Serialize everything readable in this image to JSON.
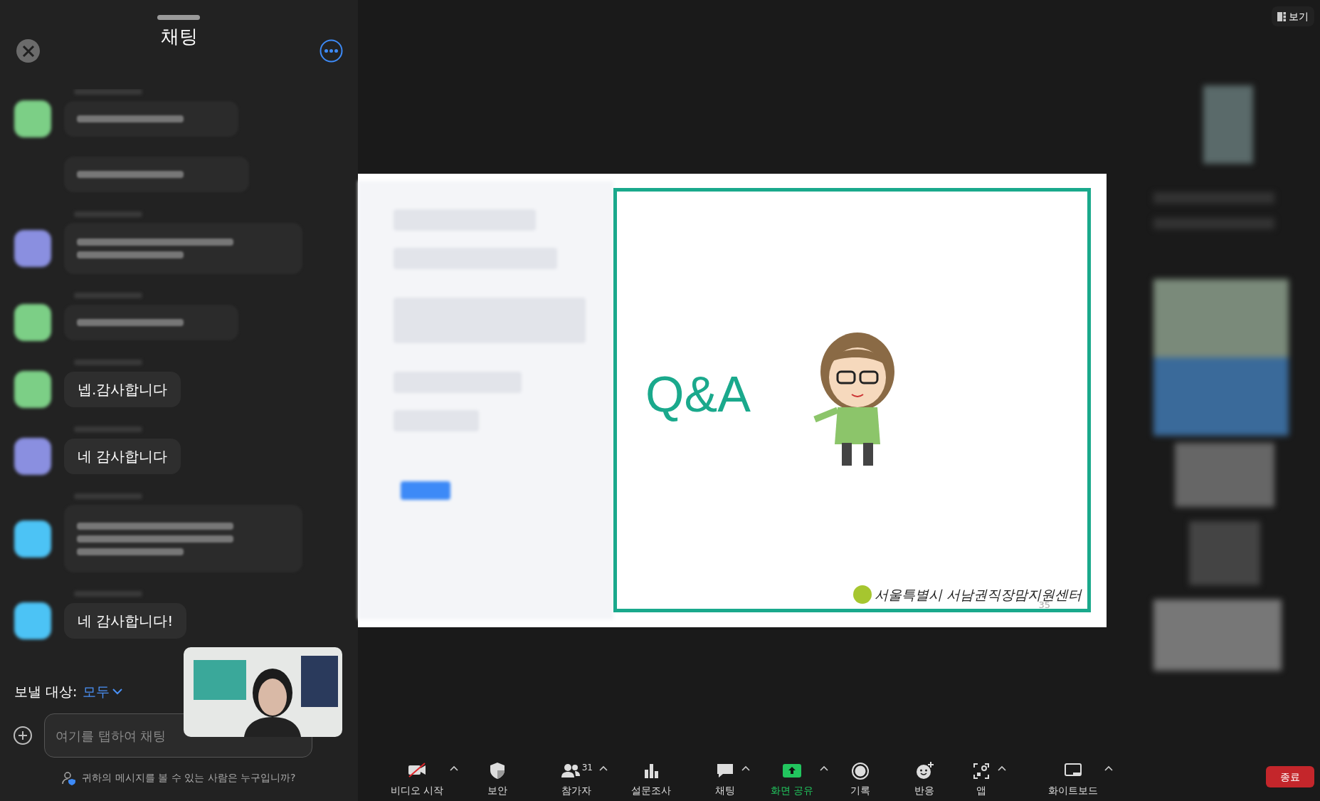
{
  "chat_panel": {
    "title": "채팅",
    "messages": [
      {
        "kind": "redacted-one-line",
        "color": "#7ccf86"
      },
      {
        "kind": "redacted-followup"
      },
      {
        "kind": "redacted-two-line",
        "color": "#8a8fe0"
      },
      {
        "kind": "redacted-one-line",
        "color": "#7ccf86"
      },
      {
        "kind": "text",
        "text": "넵.감사합니다",
        "color": "#7ccf86"
      },
      {
        "kind": "text",
        "text": "네 감사합니다",
        "color": "#8a8fe0"
      },
      {
        "kind": "redacted-three-line",
        "color": "#4cc3f5"
      },
      {
        "kind": "text",
        "text": "네 감사합니다!",
        "color": "#4cc3f5"
      }
    ],
    "send_to": {
      "label": "보낼 대상:",
      "value": "모두"
    },
    "input": {
      "placeholder": "여기를 탭하여 채팅"
    },
    "privacy_note": "귀하의 메시지를 볼 수 있는 사람은 누구입니까?"
  },
  "view_button": {
    "label": "보기"
  },
  "slide": {
    "title": "Q&A",
    "footer": "서울특별시 서남권직장맘지원센터",
    "page": "35"
  },
  "toolbar": [
    {
      "kind": "video-off",
      "label": "비디오 시작",
      "caret": true,
      "on": false
    },
    {
      "kind": "shield",
      "label": "보안",
      "caret": false,
      "on": false
    },
    {
      "kind": "people",
      "label": "참가자",
      "badge": "31",
      "caret": true,
      "on": false
    },
    {
      "kind": "chart",
      "label": "설문조사",
      "caret": false,
      "on": false
    },
    {
      "kind": "chat",
      "label": "채팅",
      "caret": true,
      "on": false
    },
    {
      "kind": "share",
      "label": "화면 공유",
      "caret": true,
      "on": true
    },
    {
      "kind": "record",
      "label": "기록",
      "caret": false,
      "on": false
    },
    {
      "kind": "smile",
      "label": "반응",
      "caret": false,
      "on": false
    },
    {
      "kind": "apps",
      "label": "앱",
      "caret": true,
      "on": false
    },
    {
      "kind": "whiteboard",
      "label": "화이트보드",
      "caret": true,
      "on": false
    }
  ],
  "end_button": {
    "label": "종료"
  }
}
